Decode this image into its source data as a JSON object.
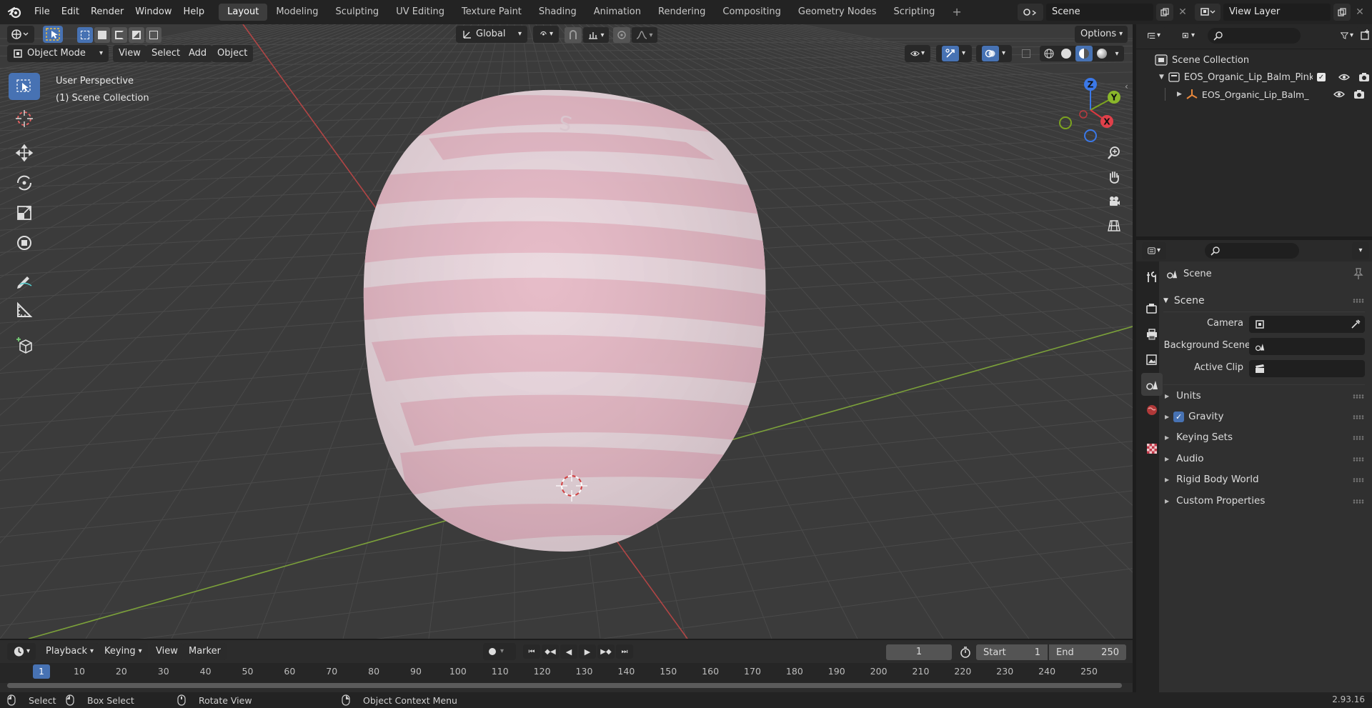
{
  "topbar": {
    "menus": [
      "File",
      "Edit",
      "Render",
      "Window",
      "Help"
    ],
    "workspaces": [
      "Layout",
      "Modeling",
      "Sculpting",
      "UV Editing",
      "Texture Paint",
      "Shading",
      "Animation",
      "Rendering",
      "Compositing",
      "Geometry Nodes",
      "Scripting"
    ],
    "active_workspace": "Layout",
    "add_tab_label": "+",
    "scene_value": "Scene",
    "view_layer_value": "View Layer"
  },
  "viewport_header": {
    "transform_orientation": "Global",
    "options_label": "Options",
    "mode": "Object Mode",
    "menus": [
      "View",
      "Select",
      "Add",
      "Object"
    ]
  },
  "viewport": {
    "perspective_label": "User Perspective",
    "collection_label": "(1) Scene Collection",
    "object_letter": "S",
    "gizmo": {
      "z": "Z",
      "y": "Y",
      "x": "X"
    },
    "colors": {
      "background": "#3b3b3b",
      "object_pink": "#e9b9c6",
      "object_light": "#ead7de",
      "axis_x": "#b24545",
      "axis_y": "#7ba03a"
    }
  },
  "outliner": {
    "root": "Scene Collection",
    "collection": "EOS_Organic_Lip_Balm_Pink_",
    "object": "EOS_Organic_Lip_Balm_I"
  },
  "properties": {
    "context_title": "Scene",
    "section_title": "Scene",
    "camera_label": "Camera",
    "background_scene_label": "Background Scene",
    "active_clip_label": "Active Clip",
    "sections": [
      "Units",
      "Gravity",
      "Keying Sets",
      "Audio",
      "Rigid Body World",
      "Custom Properties"
    ],
    "gravity_enabled": true
  },
  "timeline": {
    "menus": [
      "Playback",
      "Keying",
      "View",
      "Marker"
    ],
    "current_frame": "1",
    "start_label": "Start",
    "start_value": "1",
    "end_label": "End",
    "end_value": "250",
    "ticks": [
      "1",
      "10",
      "20",
      "30",
      "40",
      "50",
      "60",
      "70",
      "80",
      "90",
      "100",
      "110",
      "120",
      "130",
      "140",
      "150",
      "160",
      "170",
      "180",
      "190",
      "200",
      "210",
      "220",
      "230",
      "240",
      "250"
    ]
  },
  "status_bar": {
    "select": "Select",
    "box_select": "Box Select",
    "rotate_view": "Rotate View",
    "context_menu": "Object Context Menu",
    "version": "2.93.16"
  }
}
